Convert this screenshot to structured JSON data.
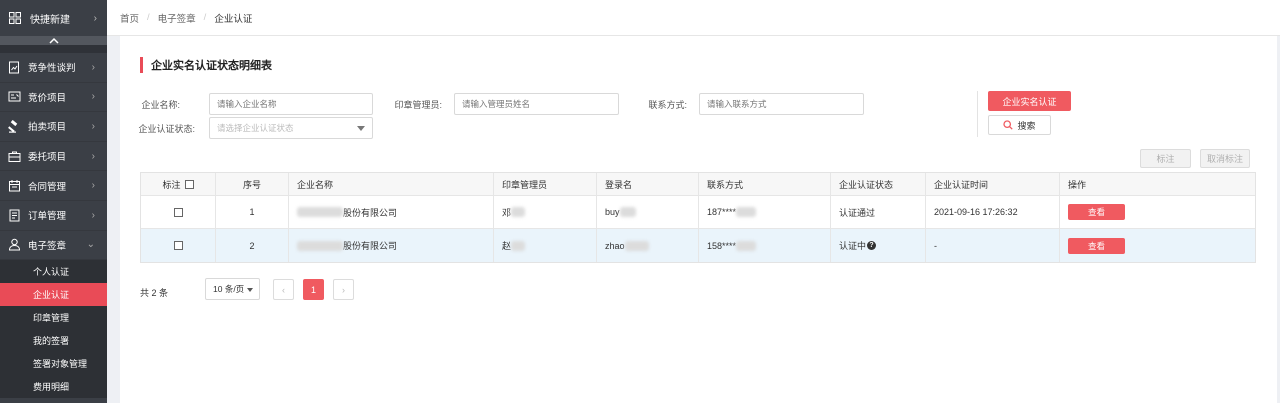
{
  "sidebar": {
    "quick": {
      "label": "快捷新建",
      "icon": "grid-icon"
    },
    "items": [
      {
        "label": "竞争性谈判",
        "icon": "document-chart-icon"
      },
      {
        "label": "竞价项目",
        "icon": "auction-list-icon"
      },
      {
        "label": "拍卖项目",
        "icon": "gavel-icon"
      },
      {
        "label": "委托项目",
        "icon": "briefcase-icon"
      },
      {
        "label": "合同管理",
        "icon": "calendar-icon"
      },
      {
        "label": "订单管理",
        "icon": "order-list-icon"
      },
      {
        "label": "电子签章",
        "icon": "user-seal-icon",
        "expanded": true
      }
    ],
    "submenu": [
      "个人认证",
      "企业认证",
      "印章管理",
      "我的签署",
      "签署对象管理",
      "费用明细"
    ],
    "active_sub": "企业认证"
  },
  "breadcrumb": [
    "首页",
    "电子签章",
    "企业认证"
  ],
  "page": {
    "title": "企业实名认证状态明细表"
  },
  "filters": {
    "company_name_label": "企业名称:",
    "company_name_placeholder": "请输入企业名称",
    "seal_admin_label": "印章管理员:",
    "seal_admin_placeholder": "请输入管理员姓名",
    "contact_label": "联系方式:",
    "contact_placeholder": "请输入联系方式",
    "status_label": "企业认证状态:",
    "status_placeholder": "请选择企业认证状态"
  },
  "actions": {
    "verify_button": "企业实名认证",
    "search_button": "搜索",
    "mark_button": "标注",
    "unmark_button": "取消标注"
  },
  "table": {
    "headers": [
      "标注",
      "序号",
      "企业名称",
      "印章管理员",
      "登录名",
      "联系方式",
      "企业认证状态",
      "企业认证时间",
      "操作"
    ],
    "rows": [
      {
        "index": "1",
        "company": "股份有限公司",
        "admin": "邓",
        "login": "buy",
        "contact": "187****",
        "status": "认证通过",
        "time": "2021-09-16 17:26:32",
        "action": "查看"
      },
      {
        "index": "2",
        "company": "股份有限公司",
        "admin": "赵",
        "login": "zhao",
        "contact": "158****",
        "status": "认证中",
        "time": "-",
        "action": "查看"
      }
    ]
  },
  "pagination": {
    "total": "共 2 条",
    "page_size": "10 条/页",
    "current_page": "1",
    "prev": "‹",
    "next": "›"
  },
  "colors": {
    "accent": "#f05a60",
    "sidebar": "#3b3f46",
    "active_sub": "#e94b57"
  }
}
